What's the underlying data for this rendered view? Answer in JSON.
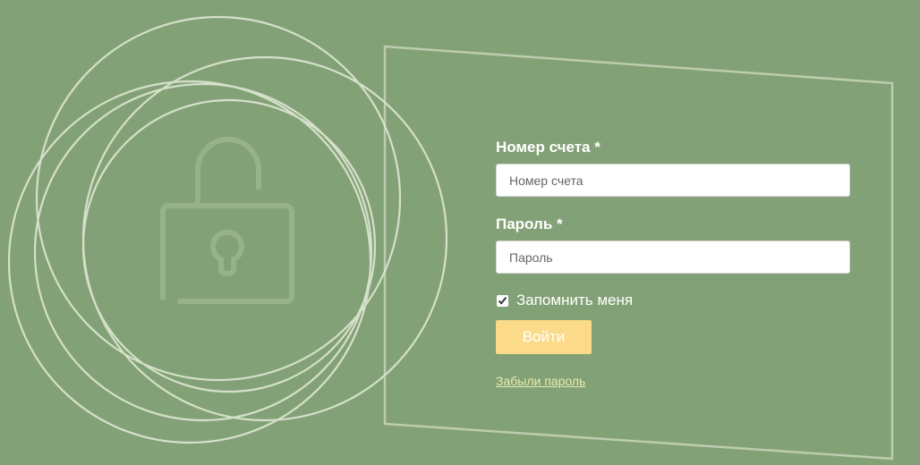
{
  "colors": {
    "background": "#83a176",
    "button": "#fbdb8a",
    "link": "#e6ecb0",
    "text": "#ffffff"
  },
  "icons": {
    "illustration": "padlock-icon"
  },
  "form": {
    "account": {
      "label": "Номер счета *",
      "placeholder": "Номер счета",
      "value": ""
    },
    "password": {
      "label": "Пароль *",
      "placeholder": "Пароль",
      "value": ""
    },
    "remember": {
      "label": "Запомнить меня",
      "checked": true
    },
    "submit_label": "Войти",
    "forgot_label": "Забыли пароль"
  }
}
